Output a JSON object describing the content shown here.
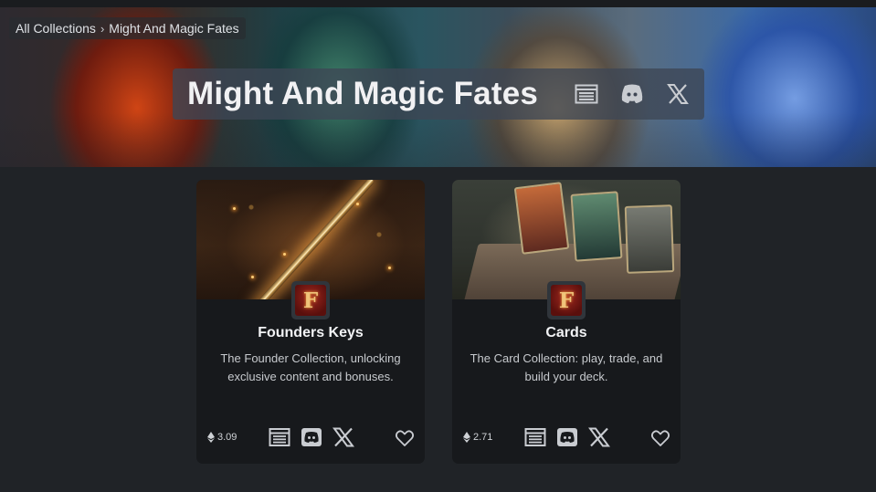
{
  "breadcrumb": {
    "root": "All Collections",
    "separator": "›",
    "current": "Might And Magic Fates"
  },
  "hero": {
    "title": "Might And Magic Fates",
    "icons": [
      "website-icon",
      "discord-icon",
      "x-icon"
    ]
  },
  "cards": [
    {
      "title": "Founders Keys",
      "description": "The Founder Collection, unlocking exclusive content and bonuses.",
      "price": "3.09",
      "price_icon": "ethereum-icon",
      "emblem_letter": "F",
      "icons": [
        "website-icon",
        "discord-icon",
        "x-icon",
        "heart-icon"
      ]
    },
    {
      "title": "Cards",
      "description": "The Card Collection: play, trade, and build your deck.",
      "price": "2.71",
      "price_icon": "ethereum-icon",
      "emblem_letter": "F",
      "icons": [
        "website-icon",
        "discord-icon",
        "x-icon",
        "heart-icon"
      ]
    }
  ],
  "colors": {
    "background": "#202327",
    "card_background": "#17191c",
    "title_box": "#3e4654",
    "icon": "#c9ccd1"
  }
}
